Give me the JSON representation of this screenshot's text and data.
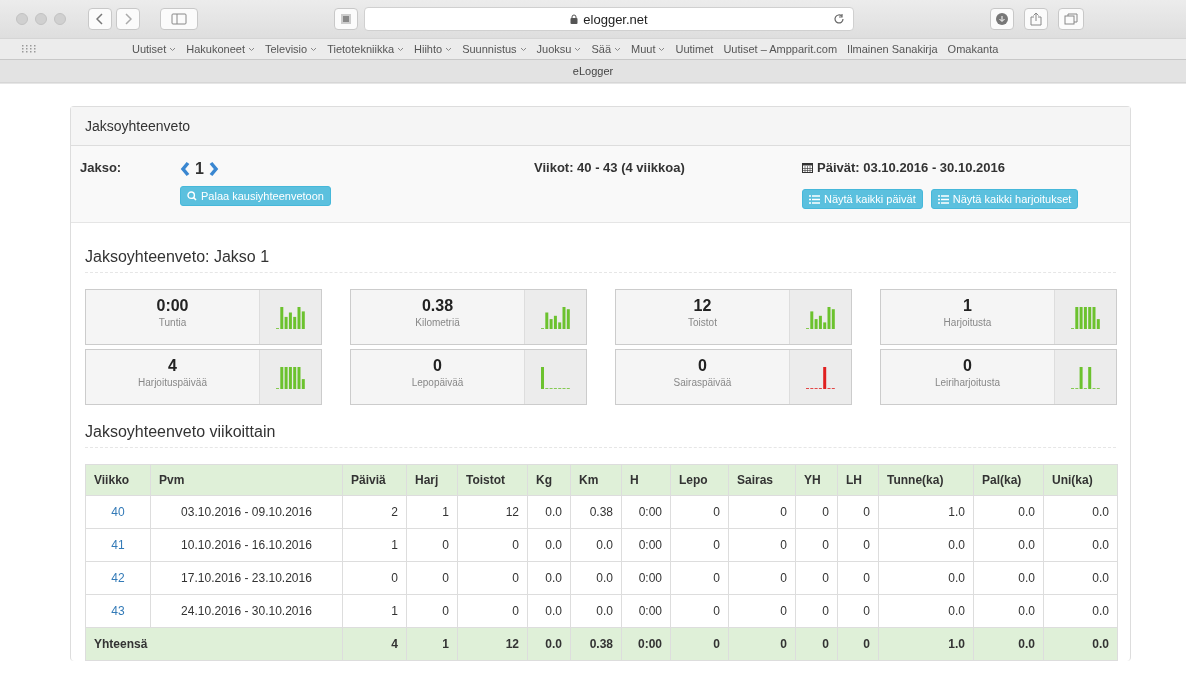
{
  "browser": {
    "url": "elogger.net",
    "bookmarks": [
      {
        "label": "Uutiset",
        "menu": true
      },
      {
        "label": "Hakukoneet",
        "menu": true
      },
      {
        "label": "Televisio",
        "menu": true
      },
      {
        "label": "Tietotekniikka",
        "menu": true
      },
      {
        "label": "Hiihto",
        "menu": true
      },
      {
        "label": "Suunnistus",
        "menu": true
      },
      {
        "label": "Juoksu",
        "menu": true
      },
      {
        "label": "Sää",
        "menu": true
      },
      {
        "label": "Muut",
        "menu": true
      },
      {
        "label": "Uutimet",
        "menu": false
      },
      {
        "label": "Uutiset – Ampparit.com",
        "menu": false
      },
      {
        "label": "Ilmainen Sanakirja",
        "menu": false
      },
      {
        "label": "Omakanta",
        "menu": false
      }
    ],
    "tab_title": "eLogger"
  },
  "panel": {
    "title": "Jaksoyhteenveto",
    "period_label": "Jakso:",
    "period_number": "1",
    "back_button": "Palaa kausiyhteenvetoon",
    "weeks": "Viikot: 40 - 43   (4 viikkoa)",
    "dates": "Päivät: 03.10.2016 - 30.10.2016",
    "buttons": [
      "Näytä kaikki päivät",
      "Näytä kaikki harjoitukset"
    ]
  },
  "summary": {
    "heading": "Jaksoyhteenveto: Jakso 1",
    "stats": [
      {
        "value": "0:00",
        "label": "Tuntia"
      },
      {
        "value": "0.38",
        "label": "Kilometriä"
      },
      {
        "value": "12",
        "label": "Toistot"
      },
      {
        "value": "1",
        "label": "Harjoitusta"
      },
      {
        "value": "4",
        "label": "Harjoituspäivää"
      },
      {
        "value": "0",
        "label": "Lepopäivää"
      },
      {
        "value": "0",
        "label": "Sairaspäivää"
      },
      {
        "value": "0",
        "label": "Leiriharjoitusta"
      }
    ]
  },
  "weekly": {
    "heading": "Jaksoyhteenveto viikoittain",
    "columns": [
      "Viikko",
      "Pvm",
      "Päiviä",
      "Harj",
      "Toistot",
      "Kg",
      "Km",
      "H",
      "Lepo",
      "Sairas",
      "YH",
      "LH",
      "Tunne(ka)",
      "Pal(ka)",
      "Uni(ka)"
    ],
    "rows": [
      [
        "40",
        "03.10.2016 - 09.10.2016",
        "2",
        "1",
        "12",
        "0.0",
        "0.38",
        "0:00",
        "0",
        "0",
        "0",
        "0",
        "1.0",
        "0.0",
        "0.0"
      ],
      [
        "41",
        "10.10.2016 - 16.10.2016",
        "1",
        "0",
        "0",
        "0.0",
        "0.0",
        "0:00",
        "0",
        "0",
        "0",
        "0",
        "0.0",
        "0.0",
        "0.0"
      ],
      [
        "42",
        "17.10.2016 - 23.10.2016",
        "0",
        "0",
        "0",
        "0.0",
        "0.0",
        "0:00",
        "0",
        "0",
        "0",
        "0",
        "0.0",
        "0.0",
        "0.0"
      ],
      [
        "43",
        "24.10.2016 - 30.10.2016",
        "1",
        "0",
        "0",
        "0.0",
        "0.0",
        "0:00",
        "0",
        "0",
        "0",
        "0",
        "0.0",
        "0.0",
        "0.0"
      ]
    ],
    "total": [
      "Yhteensä",
      "4",
      "1",
      "12",
      "0.0",
      "0.38",
      "0:00",
      "0",
      "0",
      "0",
      "0",
      "1.0",
      "0.0",
      "0.0"
    ]
  }
}
